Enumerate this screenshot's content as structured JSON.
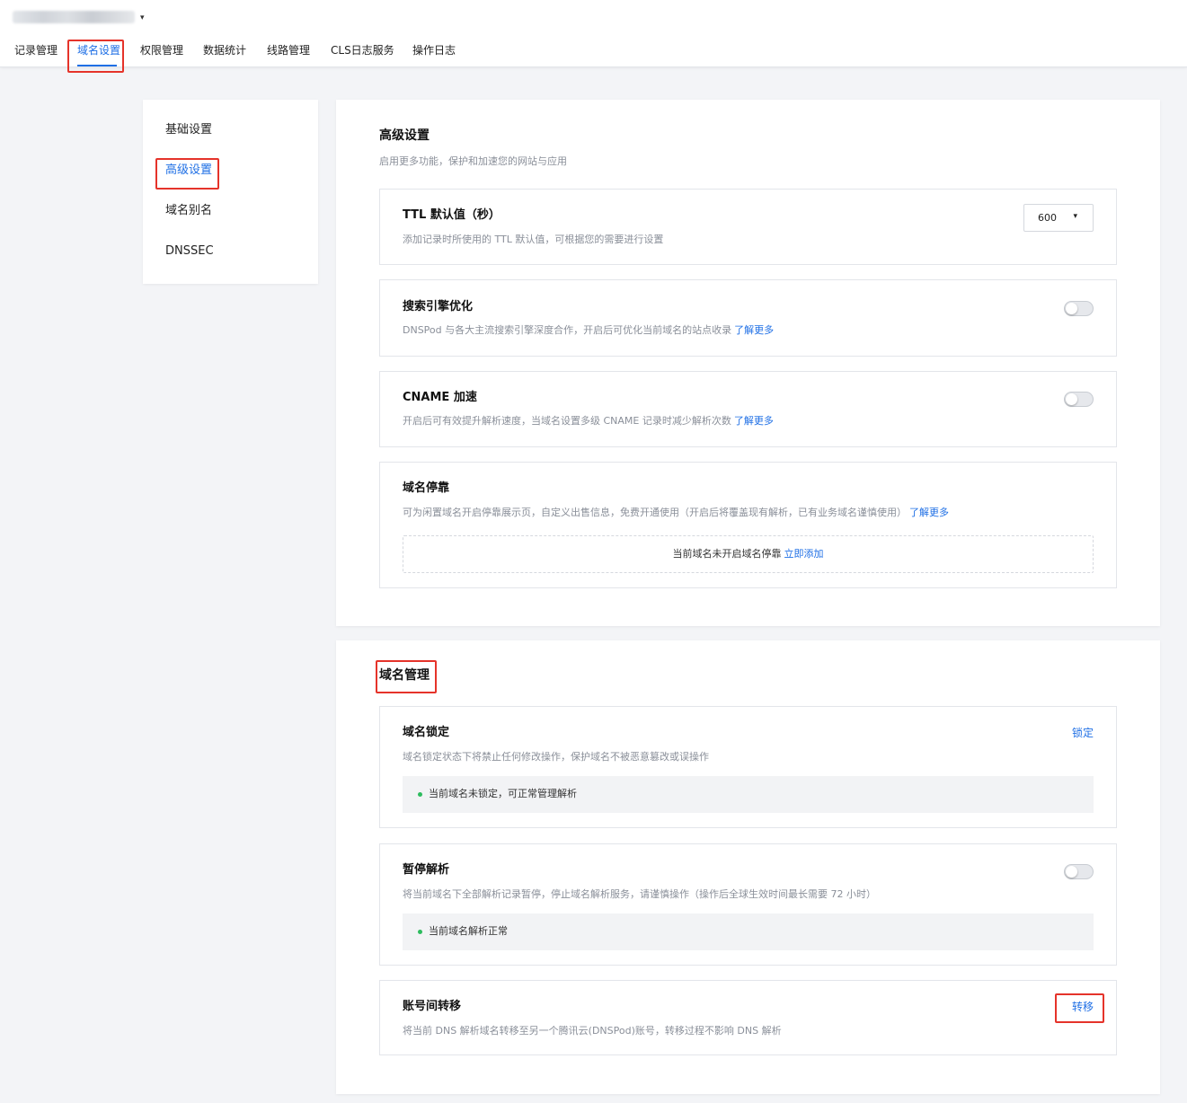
{
  "header": {
    "domain_caret": "▾",
    "tabs": [
      {
        "label": "记录管理",
        "active": false
      },
      {
        "label": "域名设置",
        "active": true
      },
      {
        "label": "权限管理",
        "active": false
      },
      {
        "label": "数据统计",
        "active": false
      },
      {
        "label": "线路管理",
        "active": false
      },
      {
        "label": "CLS日志服务",
        "active": false
      },
      {
        "label": "操作日志",
        "active": false
      }
    ]
  },
  "sidebar": {
    "items": [
      {
        "label": "基础设置",
        "active": false
      },
      {
        "label": "高级设置",
        "active": true
      },
      {
        "label": "域名别名",
        "active": false
      },
      {
        "label": "DNSSEC",
        "active": false
      }
    ]
  },
  "advanced": {
    "title": "高级设置",
    "subtitle": "启用更多功能，保护和加速您的网站与应用",
    "ttl": {
      "title": "TTL 默认值（秒）",
      "desc": "添加记录时所使用的 TTL 默认值，可根据您的需要进行设置",
      "value": "600",
      "caret": "▾"
    },
    "seo": {
      "title": "搜索引擎优化",
      "desc": "DNSPod 与各大主流搜索引擎深度合作，开启后可优化当前域名的站点收录",
      "link": "了解更多",
      "enabled": false
    },
    "cname": {
      "title": "CNAME 加速",
      "desc": "开启后可有效提升解析速度，当域名设置多级 CNAME 记录时减少解析次数",
      "link": "了解更多",
      "enabled": false
    },
    "parking": {
      "title": "域名停靠",
      "desc": "可为闲置域名开启停靠展示页，自定义出售信息，免费开通使用（开启后将覆盖现有解析，已有业务域名谨慎使用）",
      "link": "了解更多",
      "status": "当前域名未开启域名停靠",
      "action": "立即添加"
    }
  },
  "management": {
    "title": "域名管理",
    "lock": {
      "title": "域名锁定",
      "desc": "域名锁定状态下将禁止任何修改操作，保护域名不被恶意篡改或误操作",
      "action": "锁定",
      "status": "当前域名未锁定，可正常管理解析",
      "status_color": "#2dbc5e"
    },
    "pause": {
      "title": "暂停解析",
      "desc": "将当前域名下全部解析记录暂停，停止域名解析服务，请谨慎操作（操作后全球生效时间最长需要 72 小时）",
      "status": "当前域名解析正常",
      "enabled": false
    },
    "transfer": {
      "title": "账号间转移",
      "desc": "将当前 DNS 解析域名转移至另一个腾讯云(DNSPod)账号，转移过程不影响 DNS 解析",
      "action": "转移"
    }
  },
  "colors": {
    "accent": "#1f6fe5",
    "highlight": "#e5332a",
    "status_ok": "#2dbc5e"
  }
}
